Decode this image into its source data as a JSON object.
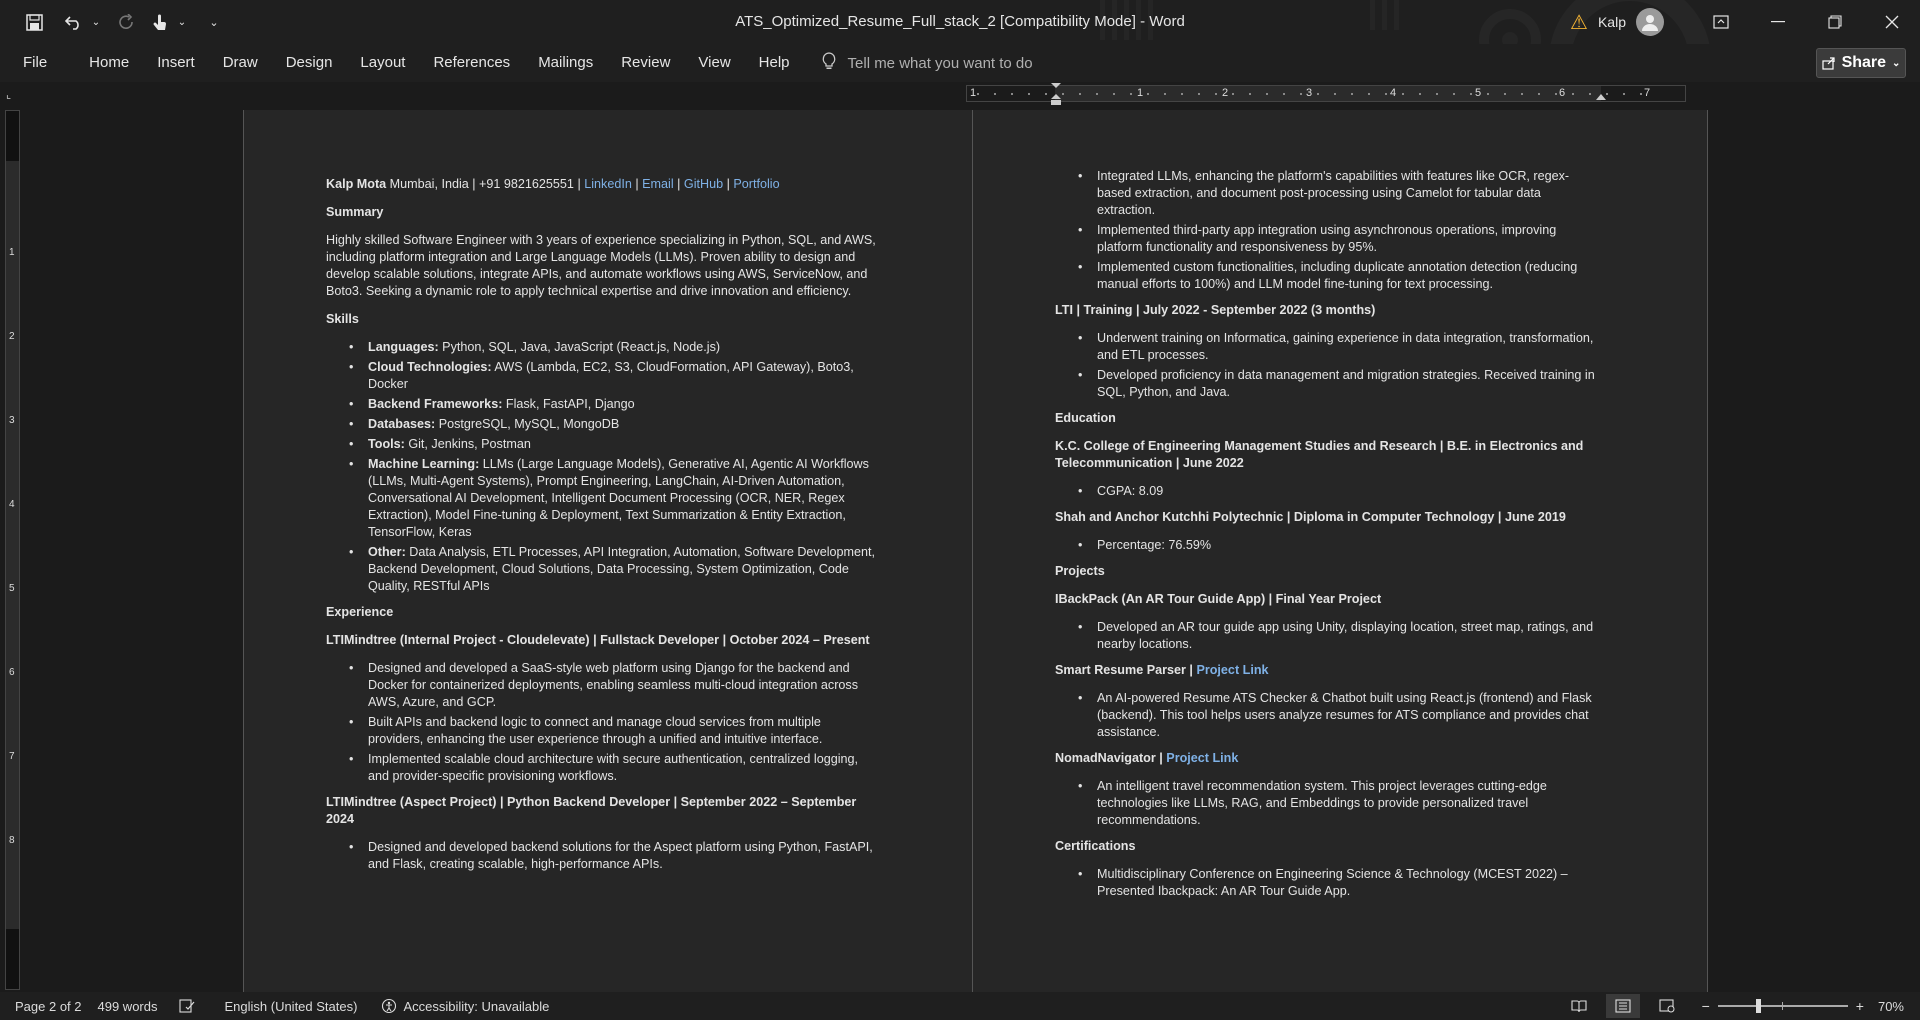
{
  "titlebar": {
    "title": "ATS_Optimized_Resume_Full_stack_2 [Compatibility Mode]  -  Word",
    "user": "Kalp"
  },
  "ribbon": {
    "tabs": [
      "File",
      "Home",
      "Insert",
      "Draw",
      "Design",
      "Layout",
      "References",
      "Mailings",
      "Review",
      "View",
      "Help"
    ],
    "tell_me_placeholder": "Tell me what you want to do",
    "share_label": "Share"
  },
  "ruler": {
    "numbers": [
      "1",
      "1",
      "2",
      "3",
      "4",
      "5",
      "6",
      "7"
    ]
  },
  "vruler": {
    "numbers": [
      "1",
      "2",
      "3",
      "4",
      "5",
      "6",
      "7",
      "8"
    ]
  },
  "page1": {
    "header_name": "Kalp Mota",
    "header_contact": " Mumbai, India | +91 9821625551 | ",
    "header_links": [
      "LinkedIn",
      "Email",
      "GitHub",
      "Portfolio"
    ],
    "summary_heading": "Summary",
    "summary_text": "Highly skilled Software Engineer with 3 years of experience specializing in Python, SQL, and AWS, including platform integration and Large Language Models (LLMs). Proven ability to design and develop scalable solutions, integrate APIs, and automate workflows using AWS, ServiceNow, and Boto3. Seeking a dynamic role to apply technical expertise and drive innovation and efficiency.",
    "skills_heading": "Skills",
    "skills": [
      {
        "label": "Languages:",
        "text": " Python, SQL, Java, JavaScript (React.js, Node.js)"
      },
      {
        "label": "Cloud Technologies:",
        "text": " AWS (Lambda, EC2, S3, CloudFormation, API Gateway), Boto3, Docker"
      },
      {
        "label": "Backend Frameworks:",
        "text": " Flask, FastAPI, Django"
      },
      {
        "label": "Databases:",
        "text": " PostgreSQL, MySQL, MongoDB"
      },
      {
        "label": "Tools:",
        "text": " Git, Jenkins, Postman"
      },
      {
        "label": "Machine Learning:",
        "text": " LLMs (Large Language Models), Generative AI, Agentic AI Workflows (LLMs, Multi-Agent Systems), Prompt Engineering, LangChain, AI-Driven Automation, Conversational AI Development, Intelligent Document Processing (OCR, NER, Regex Extraction), Model Fine-tuning & Deployment, Text Summarization & Entity Extraction, TensorFlow, Keras"
      },
      {
        "label": "Other:",
        "text": " Data Analysis, ETL Processes, API Integration, Automation, Software Development, Backend Development, Cloud Solutions, Data Processing, System Optimization, Code Quality, RESTful APIs"
      }
    ],
    "experience_heading": "Experience",
    "job1_title": "LTIMindtree (Internal Project - Cloudelevate) | Fullstack Developer | October 2024 – Present",
    "job1_bullets": [
      "Designed and developed a SaaS-style web platform using Django for the backend and Docker for containerized deployments, enabling seamless multi-cloud integration across AWS, Azure, and GCP.",
      "Built APIs and backend logic to connect and manage cloud services from multiple providers, enhancing the user experience through a unified and intuitive interface.",
      "Implemented scalable cloud architecture with secure authentication, centralized logging, and provider-specific provisioning workflows."
    ],
    "job2_title": "LTIMindtree (Aspect Project) | Python Backend Developer | September 2022 – September 2024",
    "job2_bullets": [
      "Designed and developed backend solutions for the Aspect platform using Python, FastAPI, and Flask, creating scalable, high-performance APIs."
    ]
  },
  "page2": {
    "job2_cont_bullets": [
      "Integrated LLMs, enhancing the platform's capabilities with features like OCR, regex-based extraction, and document post-processing using Camelot for tabular data extraction.",
      "Implemented third-party app integration using asynchronous operations, improving platform functionality and responsiveness by 95%.",
      "Implemented custom functionalities, including duplicate annotation detection (reducing manual efforts to 100%) and LLM model fine-tuning for text processing."
    ],
    "training_title": "LTI | Training | July 2022 - September 2022 (3 months)",
    "training_bullets": [
      "Underwent training on Informatica, gaining experience in data integration, transformation, and ETL processes.",
      "Developed proficiency in data management and migration strategies. Received training in SQL, Python, and Java."
    ],
    "education_heading": "Education",
    "edu1_title": "K.C. College of Engineering Management Studies and Research | B.E. in Electronics and Telecommunication | June 2022",
    "edu1_bullet": "CGPA: 8.09",
    "edu2_title": "Shah and Anchor Kutchhi Polytechnic | Diploma in Computer Technology | June 2019",
    "edu2_bullet": "Percentage: 76.59%",
    "projects_heading": "Projects",
    "proj1_title": "IBackPack (An AR Tour Guide App) | Final Year Project",
    "proj1_bullet": "Developed an AR tour guide app using Unity, displaying location, street map, ratings, and nearby locations.",
    "proj2_title": "Smart Resume Parser | ",
    "proj2_link": "Project Link",
    "proj2_bullet": "An AI-powered Resume ATS Checker & Chatbot built using React.js (frontend) and Flask (backend). This tool helps users analyze resumes for ATS compliance and provides chat assistance.",
    "proj3_title": "NomadNavigator | ",
    "proj3_link": "Project Link",
    "proj3_bullet": "An intelligent travel recommendation system. This project leverages cutting-edge technologies like LLMs, RAG, and Embeddings to provide personalized travel recommendations.",
    "cert_heading": "Certifications",
    "cert_bullet": "Multidisciplinary Conference on Engineering Science & Technology (MCEST 2022) – Presented Ibackpack: An AR Tour Guide App."
  },
  "status": {
    "page": "Page 2 of 2",
    "words": "499 words",
    "language": "English (United States)",
    "accessibility": "Accessibility: Unavailable",
    "zoom": "70%",
    "zoom_minus": "−",
    "zoom_plus": "+"
  },
  "colors": {
    "link": "#7fb1e6",
    "warning": "#f2b233"
  }
}
